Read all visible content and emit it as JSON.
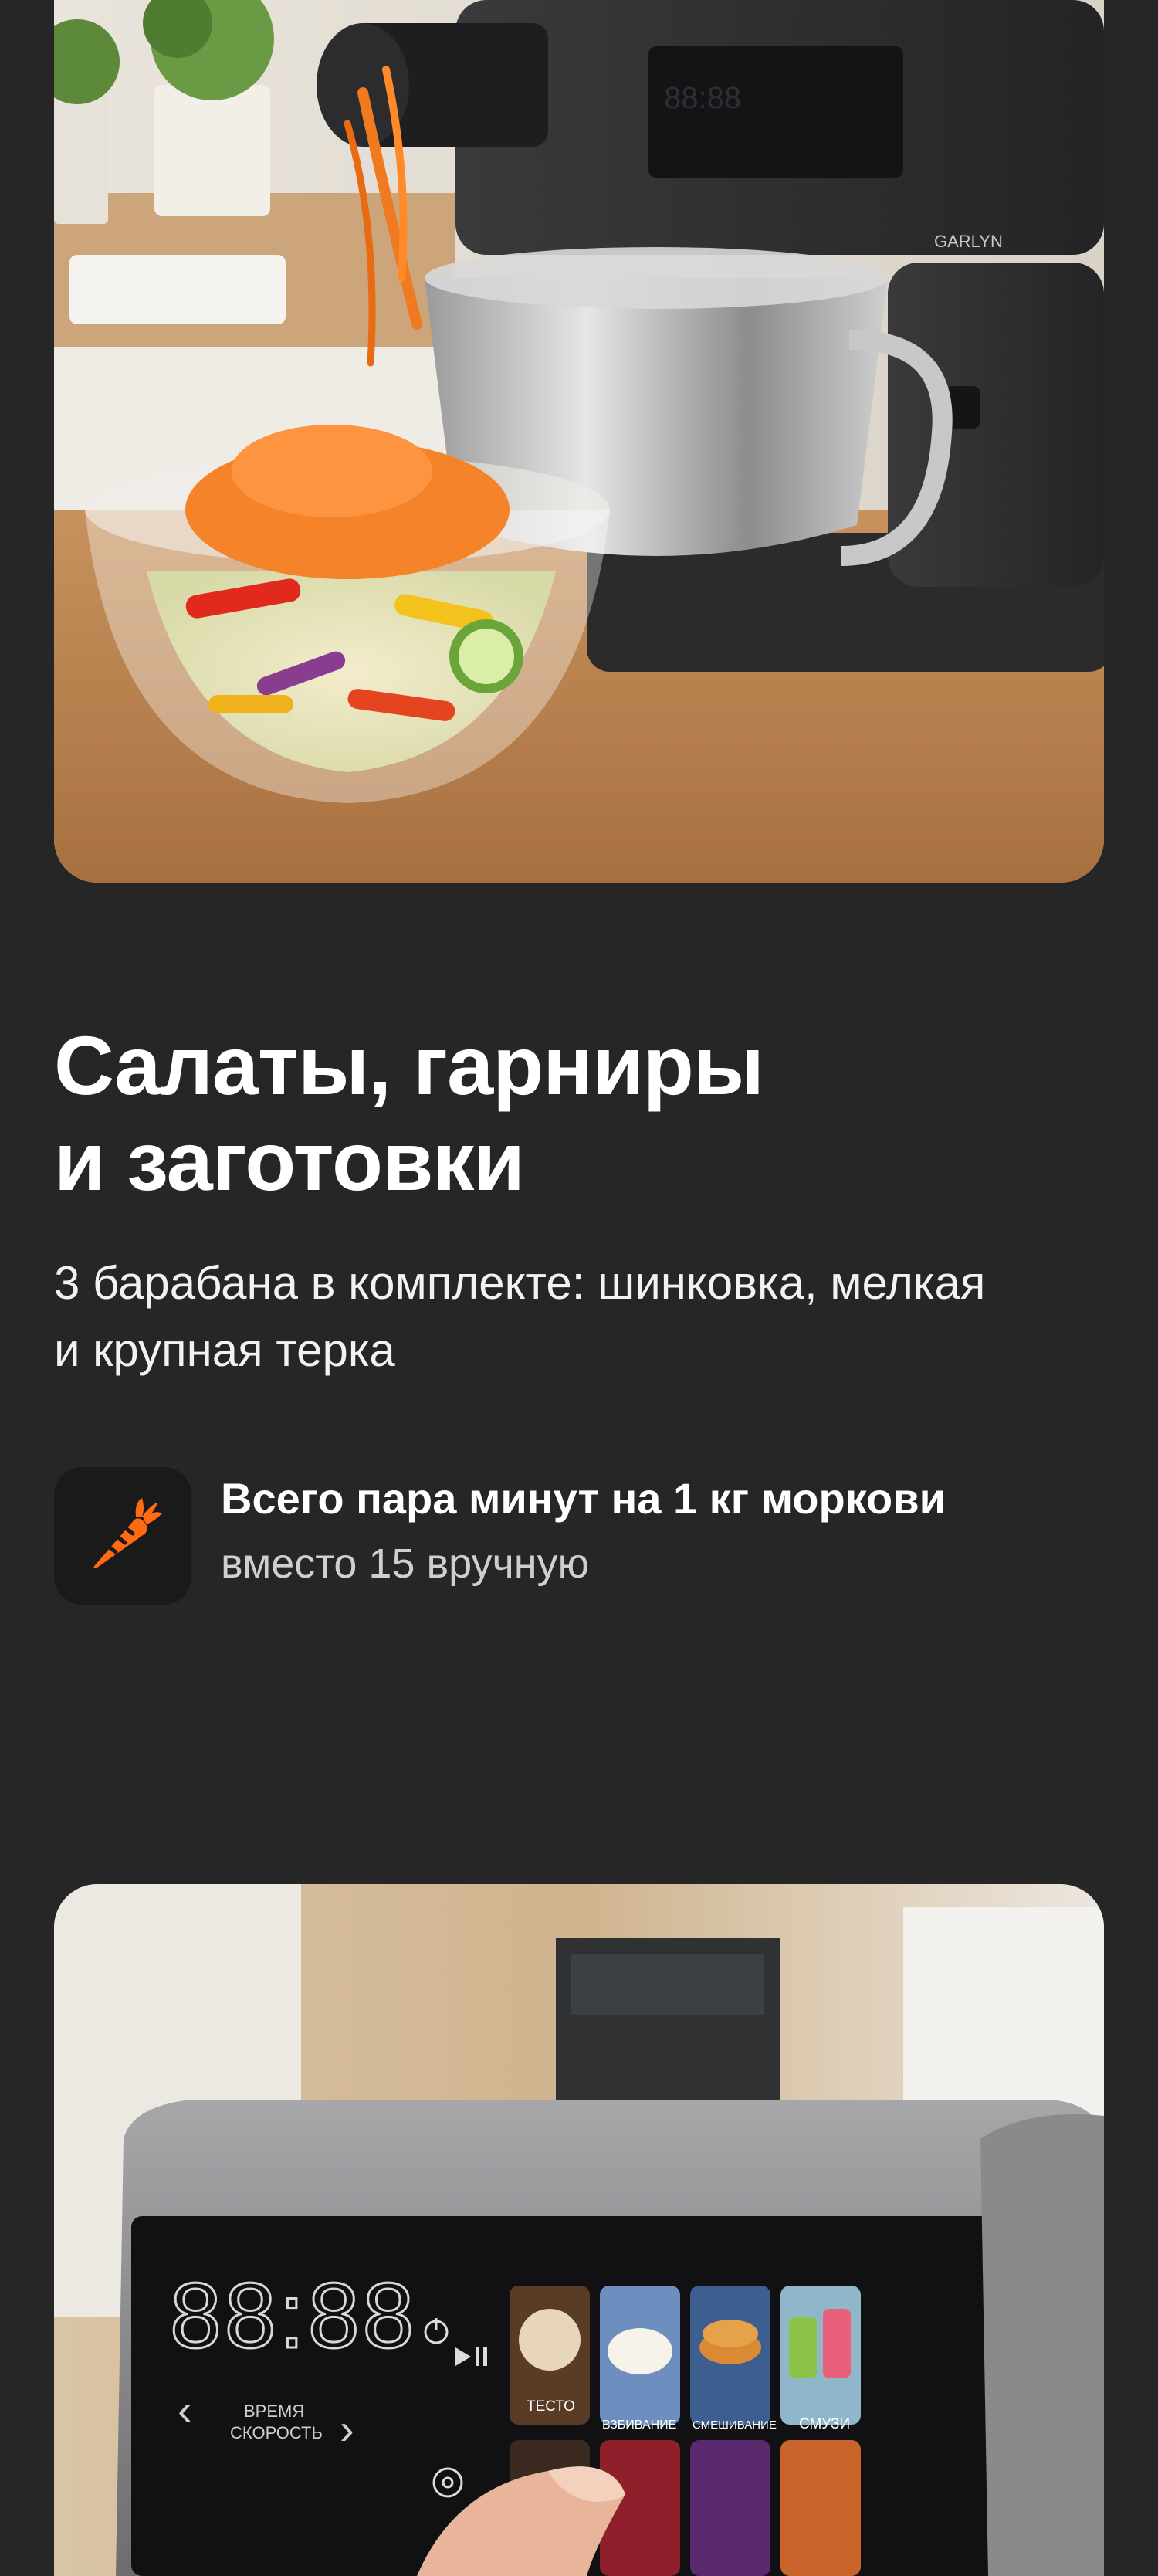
{
  "product_photo": {
    "brand_label": "GARLYN"
  },
  "section": {
    "title_line1": "Салаты, гарниры",
    "title_line2": "и заготовки",
    "subtitle_line1": "3 барабана в комплекте: шинковка, мелкая",
    "subtitle_line2": "и крупная терка"
  },
  "feature": {
    "icon": "carrot-icon",
    "title": "Всего пара минут на 1 кг моркови",
    "description": "вместо 15 вручную",
    "accent_color": "#ff6a13"
  },
  "control_panel_photo": {
    "display": "88:88",
    "time_label": "ВРЕМЯ",
    "speed_label": "СКОРОСТЬ",
    "programs": [
      "ТЕСТО",
      "ВЗБИВАНИЕ",
      "СМЕШИВАНИЕ",
      "СМУЗИ"
    ]
  }
}
